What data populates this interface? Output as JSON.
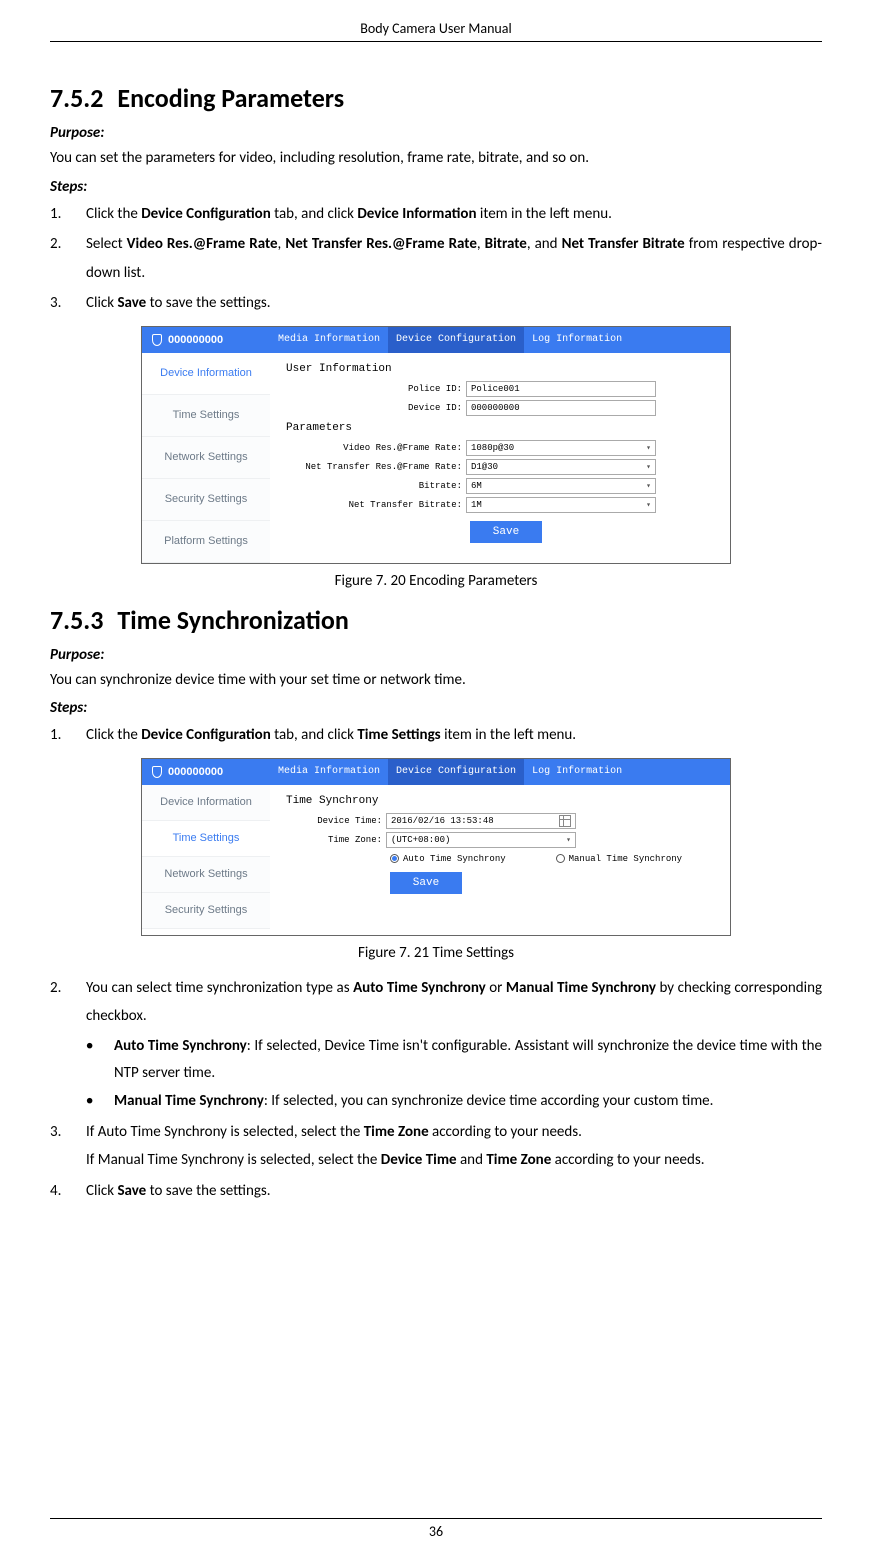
{
  "doc_title": "Body Camera User Manual",
  "page_number": "36",
  "sec1": {
    "heading_num": "7.5.2",
    "heading": "Encoding Parameters",
    "purpose_label": "Purpose:",
    "purpose_text": "You can set the parameters for video, including resolution, frame rate, bitrate, and so on.",
    "steps_label": "Steps:",
    "step1_n": "1.",
    "step1_pre": "Click the ",
    "step1_b1": "Device Configuration",
    "step1_mid": " tab, and click ",
    "step1_b2": "Device Information",
    "step1_post": " item in the left menu.",
    "step2_n": "2.",
    "step2_pre": "Select ",
    "step2_b1": "Video Res.@Frame Rate",
    "step2_c1": ", ",
    "step2_b2": "Net Transfer Res.@Frame Rate",
    "step2_c2": ", ",
    "step2_b3": "Bitrate",
    "step2_c3": ", and ",
    "step2_b4": "Net Transfer Bitrate",
    "step2_post": " from respective drop-down list.",
    "step3_n": "3.",
    "step3_pre": "Click ",
    "step3_b1": "Save",
    "step3_post": " to save the settings."
  },
  "fig1_caption": "Figure 7. 20 Encoding Parameters",
  "shot1": {
    "device_id": "000000000",
    "topmenu": [
      "Media Information",
      "Device Configuration",
      "Log Information"
    ],
    "sidebar": [
      "Device Information",
      "Time Settings",
      "Network Settings",
      "Security Settings",
      "Platform Settings"
    ],
    "sidebar_active": 0,
    "sect_user": "User Information",
    "lbl_police": "Police ID:",
    "val_police": "Police001",
    "lbl_device": "Device ID:",
    "val_device": "000000000",
    "sect_params": "Parameters",
    "lbl_video": "Video Res.@Frame Rate:",
    "val_video": "1080p@30",
    "lbl_nettrans": "Net Transfer Res.@Frame Rate:",
    "val_nettrans": "D1@30",
    "lbl_bitrate": "Bitrate:",
    "val_bitrate": "6M",
    "lbl_netbitrate": "Net Transfer Bitrate:",
    "val_netbitrate": "1M",
    "save": "Save"
  },
  "sec2": {
    "heading_num": "7.5.3",
    "heading": "Time Synchronization",
    "purpose_label": "Purpose:",
    "purpose_text": "You can synchronize device time with your set time or network time.",
    "steps_label": "Steps:",
    "step1_n": "1.",
    "step1_pre": "Click the ",
    "step1_b1": "Device Configuration",
    "step1_mid": " tab, and click ",
    "step1_b2": "Time Settings",
    "step1_post": " item in the left menu."
  },
  "fig2_caption": "Figure 7. 21 Time Settings",
  "shot2": {
    "device_id": "000000000",
    "topmenu": [
      "Media Information",
      "Device Configuration",
      "Log Information"
    ],
    "sidebar": [
      "Device Information",
      "Time Settings",
      "Network Settings",
      "Security Settings"
    ],
    "sidebar_active": 1,
    "sect": "Time Synchrony",
    "lbl_devtime": "Device Time:",
    "val_devtime": "2016/02/16 13:53:48",
    "lbl_tz": "Time Zone:",
    "val_tz": "(UTC+08:00)",
    "radio_auto": "Auto Time Synchrony",
    "radio_manual": "Manual Time Synchrony",
    "save": "Save"
  },
  "sec2b": {
    "step2_n": "2.",
    "step2_pre": "You can select time synchronization type as ",
    "step2_b1": "Auto Time Synchrony",
    "step2_mid": " or ",
    "step2_b2": "Manual Time Synchrony",
    "step2_post": " by checking corresponding checkbox.",
    "bul1_b": "Auto Time Synchrony",
    "bul1_t": ": If selected, Device Time isn't configurable. Assistant will synchronize the device time with the NTP server time.",
    "bul2_b": "Manual Time Synchrony",
    "bul2_t": ": If selected, you can synchronize device time according your custom time.",
    "step3_n": "3.",
    "step3_a": "If Auto Time Synchrony is selected, select the ",
    "step3_b1": "Time Zone",
    "step3_c": " according to your needs.",
    "step3_line2a": "If Manual Time Synchrony is selected, select the ",
    "step3_line2b1": "Device Time",
    "step3_line2mid": " and ",
    "step3_line2b2": "Time Zone",
    "step3_line2post": " according to your needs.",
    "step4_n": "4.",
    "step4_pre": "Click ",
    "step4_b1": "Save",
    "step4_post": " to save the settings."
  }
}
